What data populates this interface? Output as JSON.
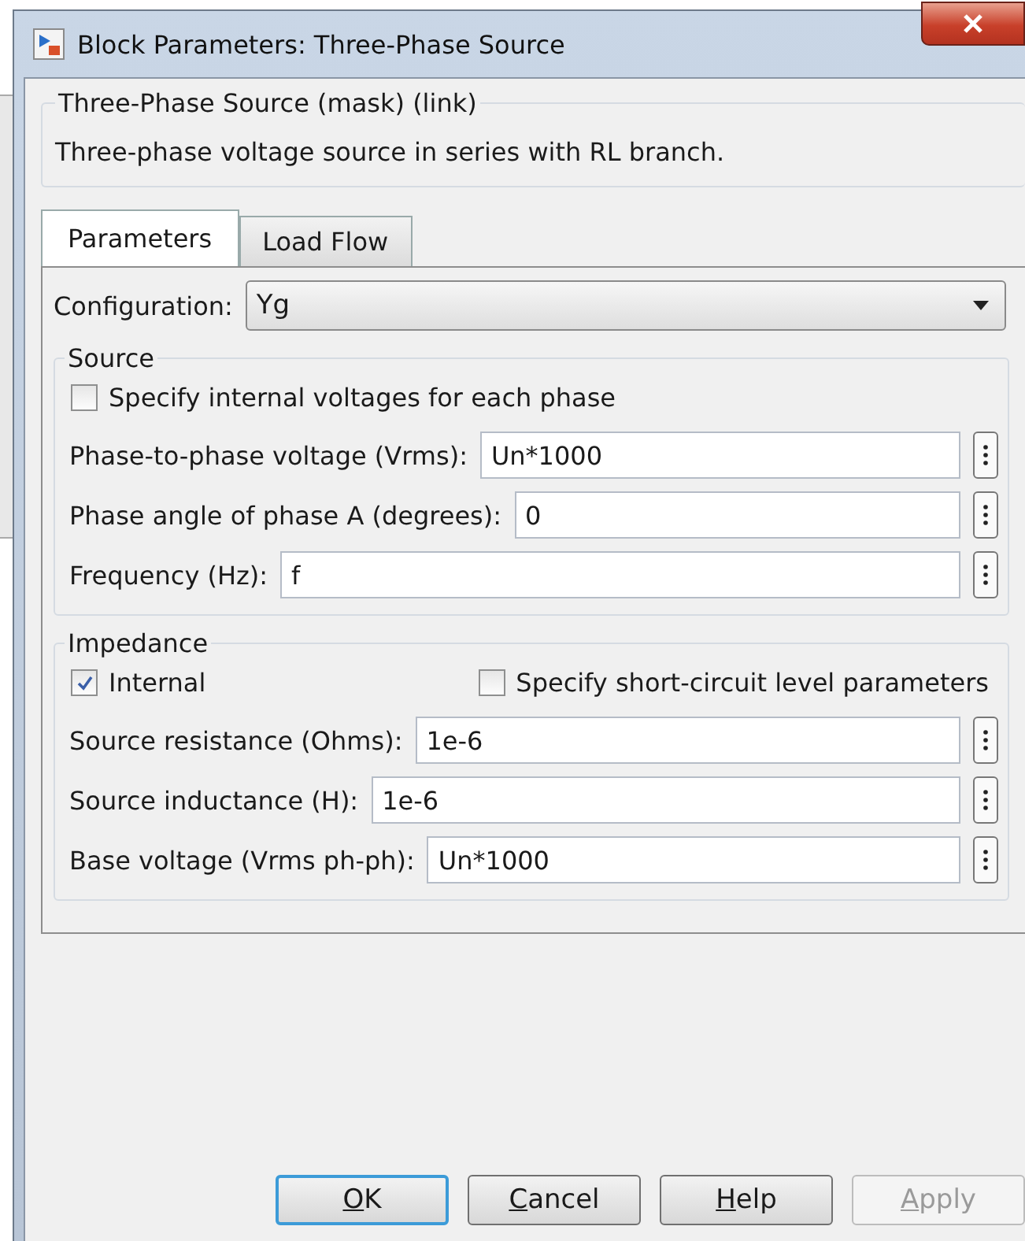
{
  "window": {
    "title": "Block Parameters: Three-Phase Source"
  },
  "mask": {
    "title": "Three-Phase Source (mask) (link)",
    "description": "Three-phase voltage source in series with RL branch."
  },
  "tabs": [
    {
      "label": "Parameters",
      "selected": true
    },
    {
      "label": "Load Flow",
      "selected": false
    }
  ],
  "configuration": {
    "label": "Configuration:",
    "value": "Yg"
  },
  "groups": [
    {
      "title": "Source",
      "checkboxes": [
        {
          "label": "Specify internal voltages for each phase",
          "checked": false
        }
      ],
      "fields": [
        {
          "label": "Phase-to-phase voltage (Vrms):",
          "value": "Un*1000"
        },
        {
          "label": "Phase angle of phase A (degrees):",
          "value": "0"
        },
        {
          "label": "Frequency (Hz):",
          "value": "f"
        }
      ]
    },
    {
      "title": "Impedance",
      "checkboxes": [
        {
          "label": "Internal",
          "checked": true
        },
        {
          "label": "Specify short-circuit level parameters",
          "checked": false
        }
      ],
      "fields": [
        {
          "label": "Source resistance (Ohms):",
          "value": "1e-6"
        },
        {
          "label": "Source inductance (H):",
          "value": "1e-6"
        },
        {
          "label": "Base voltage (Vrms ph-ph):",
          "value": "Un*1000"
        }
      ]
    }
  ],
  "buttons": [
    {
      "label": "OK",
      "default": true,
      "disabled": false
    },
    {
      "label": "Cancel",
      "default": false,
      "disabled": false
    },
    {
      "label": "Help",
      "default": false,
      "disabled": false
    },
    {
      "label": "Apply",
      "default": false,
      "disabled": true
    }
  ]
}
